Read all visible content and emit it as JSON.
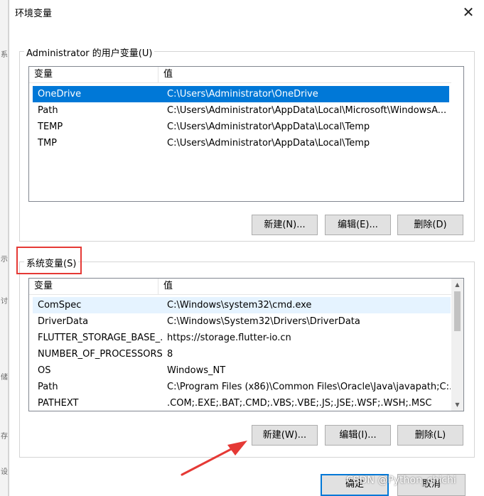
{
  "dialog": {
    "title": "环境变量",
    "close_glyph": "✕"
  },
  "left_strip": [
    "系",
    "示",
    "讨",
    "储",
    "存",
    "设"
  ],
  "user_vars": {
    "group_label": "Administrator 的用户变量(U)",
    "header": {
      "name": "变量",
      "value": "值"
    },
    "rows": [
      {
        "name": "OneDrive",
        "value": "C:\\Users\\Administrator\\OneDrive",
        "selected": true
      },
      {
        "name": "Path",
        "value": "C:\\Users\\Administrator\\AppData\\Local\\Microsoft\\WindowsA..."
      },
      {
        "name": "TEMP",
        "value": "C:\\Users\\Administrator\\AppData\\Local\\Temp"
      },
      {
        "name": "TMP",
        "value": "C:\\Users\\Administrator\\AppData\\Local\\Temp"
      }
    ],
    "buttons": {
      "new": "新建(N)...",
      "edit": "编辑(E)...",
      "delete": "删除(D)"
    }
  },
  "system_vars": {
    "group_label": "系统变量(S)",
    "header": {
      "name": "变量",
      "value": "值"
    },
    "rows": [
      {
        "name": "ComSpec",
        "value": "C:\\Windows\\system32\\cmd.exe",
        "highlighted": true
      },
      {
        "name": "DriverData",
        "value": "C:\\Windows\\System32\\Drivers\\DriverData"
      },
      {
        "name": "FLUTTER_STORAGE_BASE_...",
        "value": "https://storage.flutter-io.cn"
      },
      {
        "name": "NUMBER_OF_PROCESSORS",
        "value": "8"
      },
      {
        "name": "OS",
        "value": "Windows_NT"
      },
      {
        "name": "Path",
        "value": "C:\\Program Files (x86)\\Common Files\\Oracle\\Java\\javapath;C:..."
      },
      {
        "name": "PATHEXT",
        "value": ".COM;.EXE;.BAT;.CMD;.VBS;.VBE;.JS;.JSE;.WSF;.WSH;.MSC"
      }
    ],
    "buttons": {
      "new": "新建(W)...",
      "edit": "编辑(I)...",
      "delete": "删除(L)"
    }
  },
  "footer": {
    "ok": "确定",
    "cancel": "取消"
  },
  "watermark": "CSDN @Python_chichi",
  "colors": {
    "selection": "#0078d7",
    "annotation": "#e53935"
  }
}
